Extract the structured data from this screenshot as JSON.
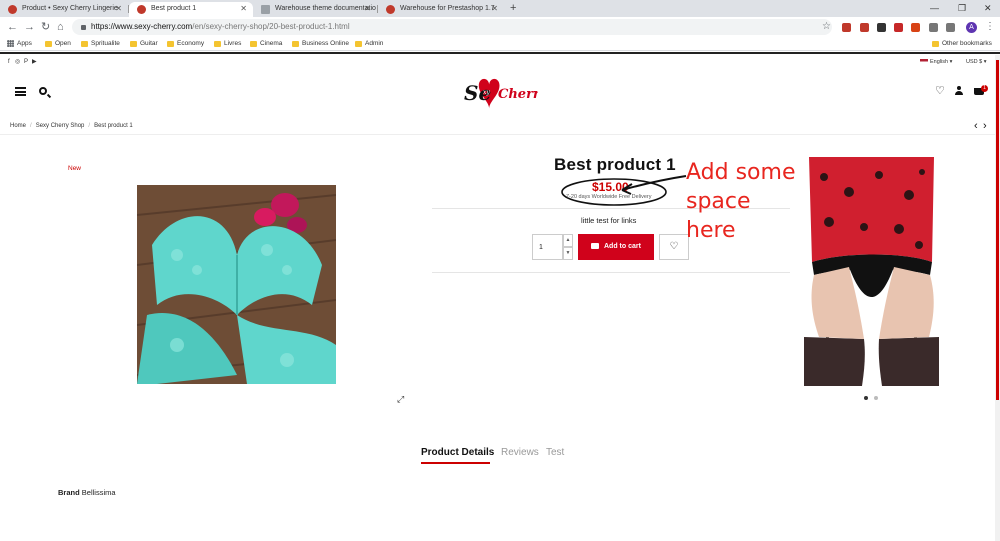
{
  "browser": {
    "tabs": [
      {
        "title": "Product • Sexy Cherry Lingerie",
        "active": false
      },
      {
        "title": "Best product 1",
        "active": true
      },
      {
        "title": "Warehouse theme documentatio",
        "active": false
      },
      {
        "title": "Warehouse for Prestashop 1.7",
        "active": false
      }
    ],
    "new_tab": "+",
    "window_controls": [
      "—",
      "❐",
      "✕"
    ],
    "url_host": "https://www.sexy-cherry.com",
    "url_path": "/en/sexy-cherry-shop/20-best-product-1.html",
    "profile_initial": "A",
    "bookmarks": [
      "Apps",
      "Open",
      "Spritualite",
      "Guitar",
      "Economy",
      "Livres",
      "Cinema",
      "Business Online",
      "Admin"
    ],
    "other_bookmarks": "Other bookmarks",
    "extension_colors": [
      "#c0392b",
      "#c0392b",
      "#333333",
      "#c62828",
      "#d84315",
      "#777777",
      "#777777",
      "#c62828"
    ]
  },
  "topbar": {
    "social_icons": [
      "f",
      "◎",
      "P",
      "▶"
    ],
    "language": "English",
    "currency": "USD $"
  },
  "header": {
    "logo_text_left": "Se",
    "logo_text_right": "Cherry",
    "logo_heart_text": "xy",
    "cart_count": "1"
  },
  "breadcrumb": [
    "Home",
    "Sexy Cherry Shop",
    "Best product 1"
  ],
  "product": {
    "badge": "New",
    "title": "Best product 1",
    "price": "$15.00",
    "delivery": "7-20 days Worldwide Free Delivery",
    "short_description": "little test for links",
    "quantity": "1",
    "add_to_cart_label": "Add to cart"
  },
  "annotation": "Add some space here",
  "tabs": [
    {
      "label": "Product Details",
      "active": true
    },
    {
      "label": "Reviews",
      "active": false
    },
    {
      "label": "Test",
      "active": false
    }
  ],
  "details": {
    "brand_label": "Brand",
    "brand_value": "Bellissima"
  },
  "colors": {
    "accent": "#d0021b",
    "annotation": "#e8261f"
  }
}
